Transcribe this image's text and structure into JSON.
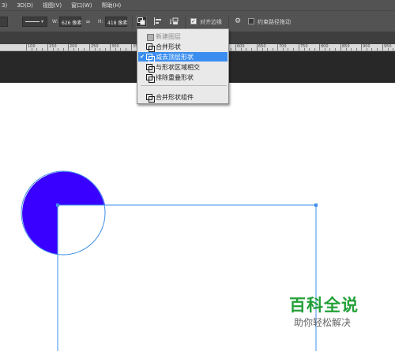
{
  "menubar": {
    "items": [
      "3)",
      "3D(D)",
      "视图(V)",
      "窗口(W)",
      "帮助(H)"
    ]
  },
  "options": {
    "w_label": "W:",
    "w_value": "626 像素",
    "link_icon": "link-icon",
    "h_label": "H:",
    "h_value": "418 像素",
    "align_edges_label": "对齐边缘",
    "align_edges_checked": true,
    "constrain_path_label": "约束路径拖动",
    "constrain_path_checked": false
  },
  "ruler": {
    "labels": [
      "100",
      "150",
      "200",
      "250",
      "300",
      "350",
      "400",
      "450",
      "500",
      "550",
      "600",
      "650",
      "700",
      "750",
      "800",
      "850",
      "900",
      "950"
    ]
  },
  "dropdown": {
    "items": [
      {
        "label": "新建图层",
        "disabled": true,
        "selected": false
      },
      {
        "label": "合并形状",
        "disabled": false,
        "selected": false
      },
      {
        "label": "减去顶层形状",
        "disabled": false,
        "selected": true
      },
      {
        "label": "与形状区域相交",
        "disabled": false,
        "selected": false
      },
      {
        "label": "排除重叠形状",
        "disabled": false,
        "selected": false
      },
      {
        "label": "合并形状组件",
        "disabled": false,
        "selected": false
      }
    ]
  },
  "canvas": {
    "circle_color": "#3a00ff",
    "path_color": "#3d8fe8"
  },
  "watermark": {
    "title": "百科全说",
    "subtitle": "助你轻松解决"
  }
}
